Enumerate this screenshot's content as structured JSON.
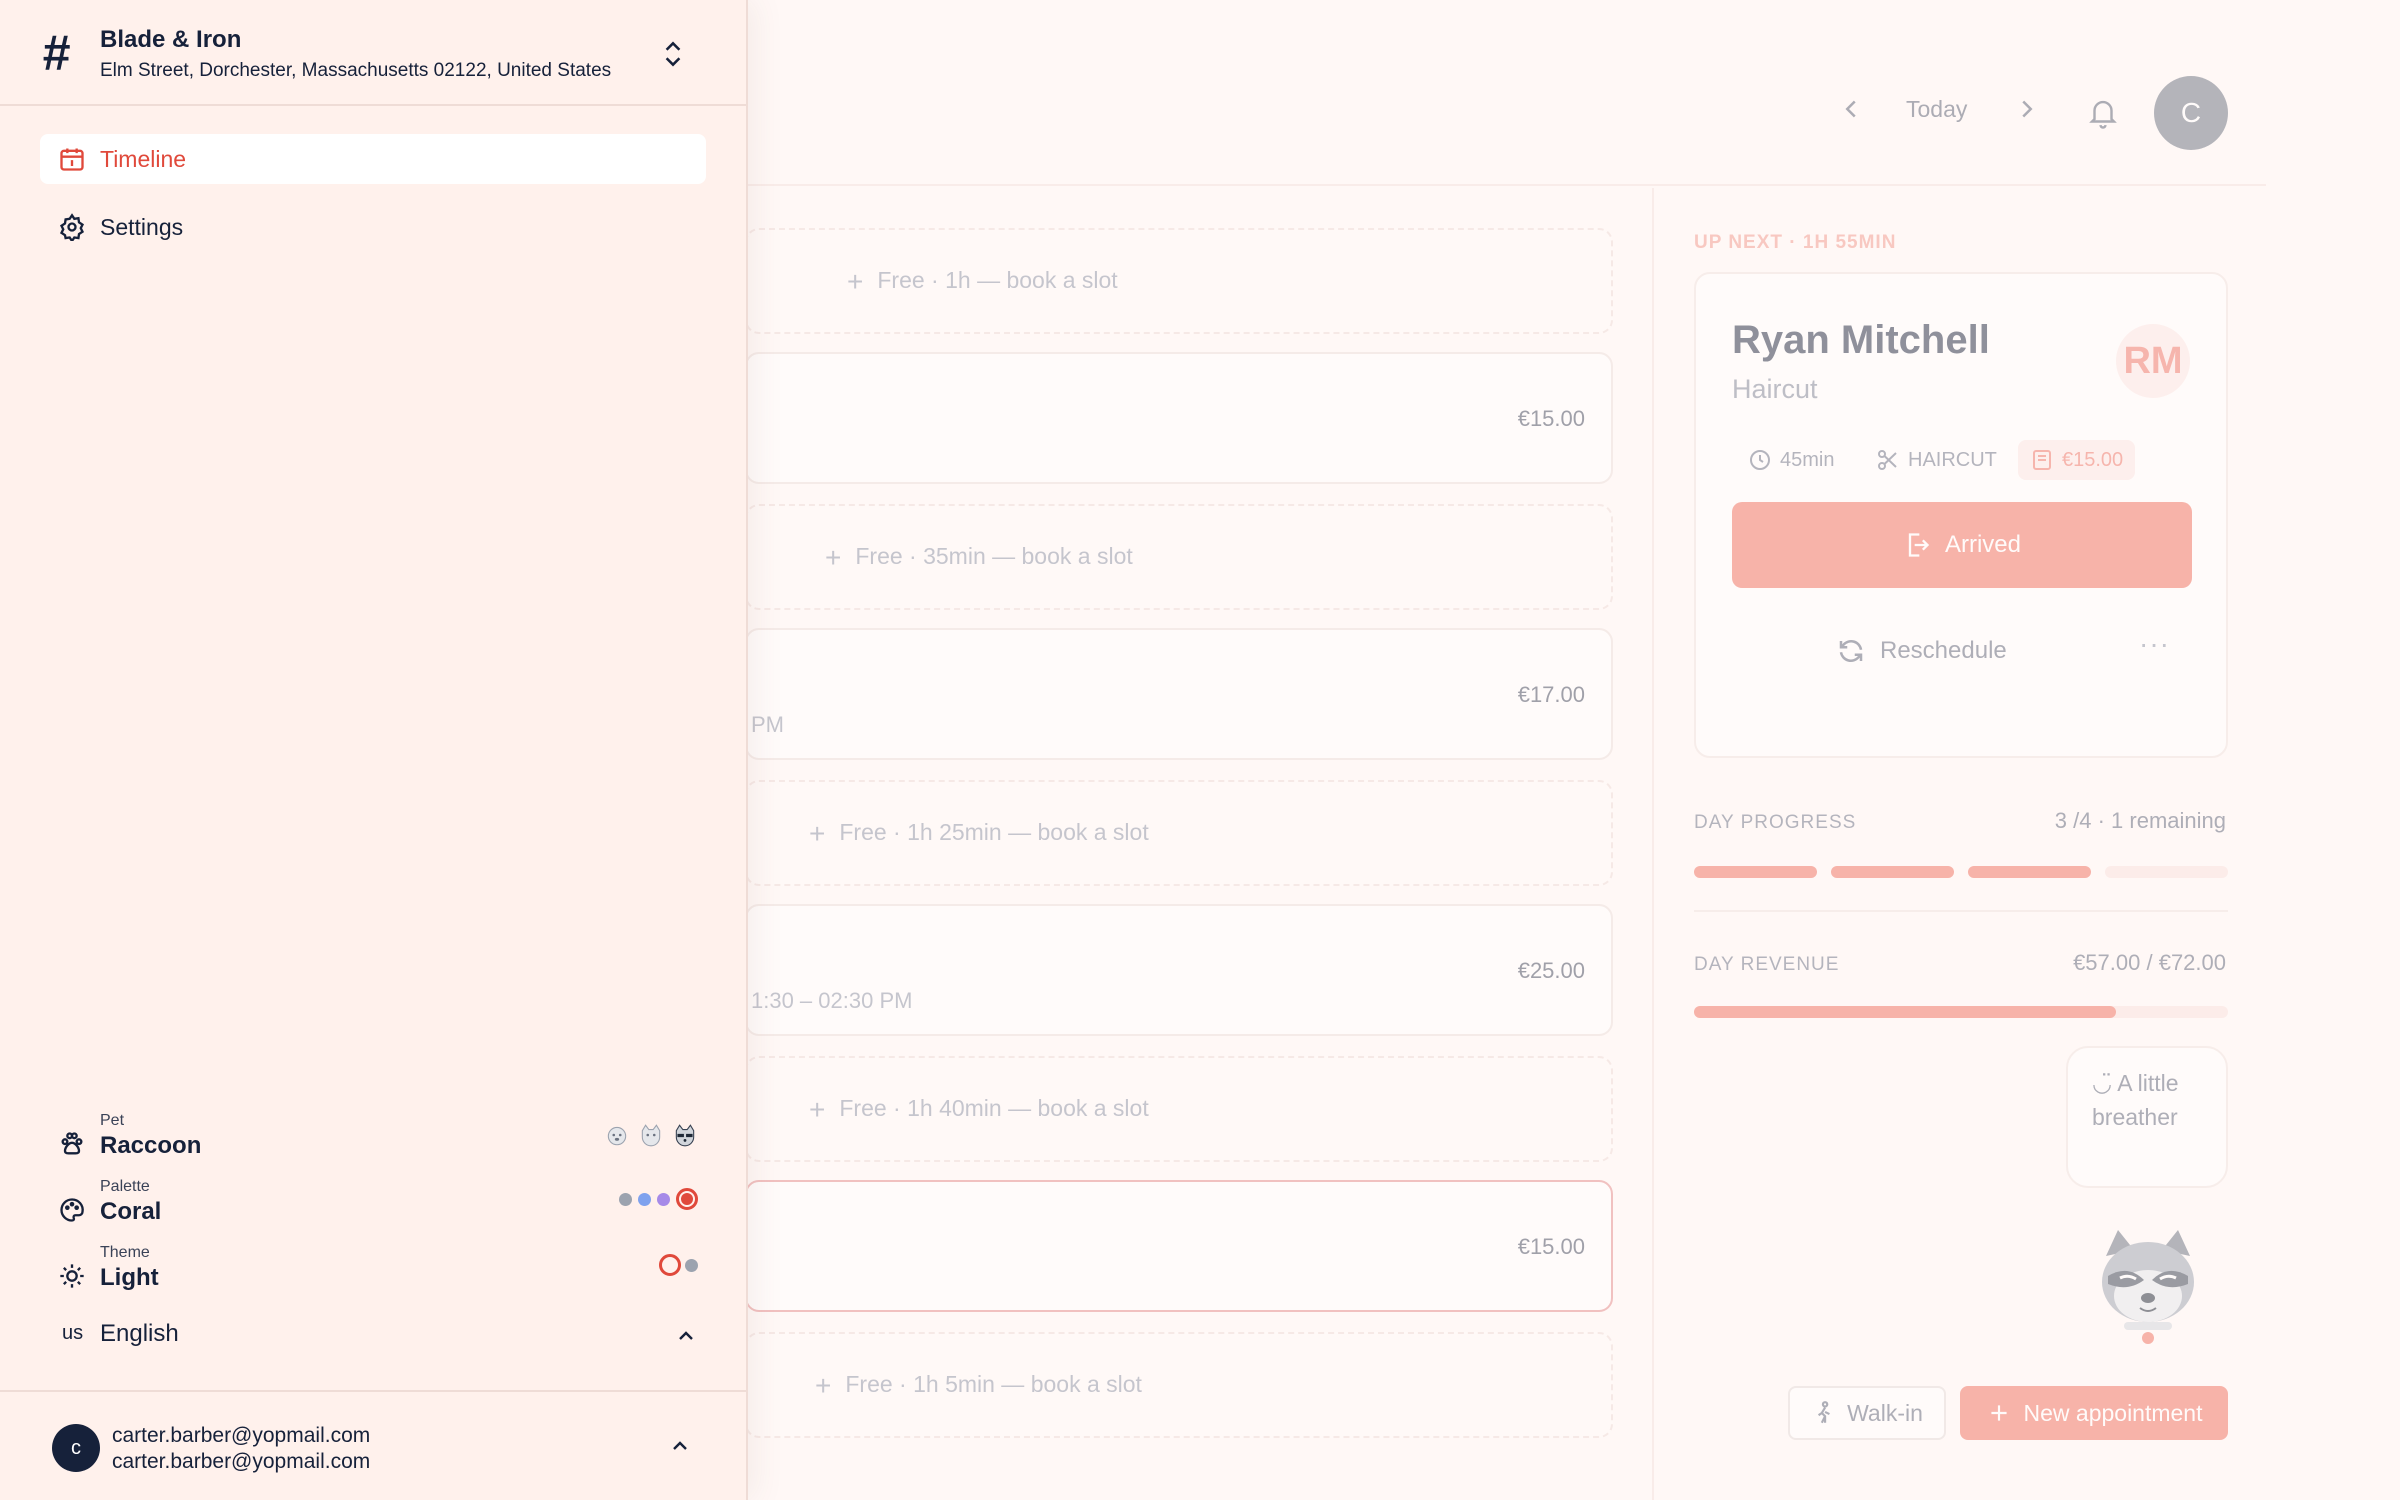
{
  "org": {
    "name": "Blade & Iron",
    "address": "Elm Street, Dorchester, Massachusetts 02122, United States"
  },
  "nav": {
    "items": [
      {
        "label": "Timeline",
        "icon": "calendar-icon",
        "active": true
      },
      {
        "label": "Settings",
        "icon": "gear-icon",
        "active": false
      }
    ]
  },
  "prefs": {
    "pet": {
      "label": "Pet",
      "value": "Raccoon"
    },
    "palette": {
      "label": "Palette",
      "value": "Coral"
    },
    "theme": {
      "label": "Theme",
      "value": "Light"
    },
    "language": {
      "flag": "us",
      "value": "English"
    }
  },
  "user": {
    "avatar": "c",
    "email": "carter.barber@yopmail.com",
    "email_secondary": "carter.barber@yopmail.com"
  },
  "topbar": {
    "today_label": "Today",
    "avatar": "C"
  },
  "timeline": {
    "slots": [
      {
        "kind": "free",
        "text": "Free · 1h — book a slot"
      },
      {
        "kind": "appt",
        "price": "€15.00",
        "sub": ""
      },
      {
        "kind": "free",
        "text": "Free · 35min — book a slot"
      },
      {
        "kind": "appt",
        "price": "€17.00",
        "sub": "PM"
      },
      {
        "kind": "free",
        "text": "Free · 1h 25min — book a slot"
      },
      {
        "kind": "appt",
        "price": "€25.00",
        "sub": "1:30 – 02:30 PM"
      },
      {
        "kind": "free",
        "text": "Free · 1h 40min — book a slot"
      },
      {
        "kind": "appt",
        "price": "€15.00",
        "sub": "",
        "highlight": true
      },
      {
        "kind": "free",
        "text": "Free · 1h 5min — book a slot"
      }
    ]
  },
  "upnext": {
    "label": "UP NEXT · 1H 55MIN",
    "name": "Ryan Mitchell",
    "service": "Haircut",
    "initials": "RM",
    "duration": "45min",
    "category": "HAIRCUT",
    "price": "€15.00",
    "arrived_label": "Arrived",
    "reschedule_label": "Reschedule",
    "more_label": "···"
  },
  "day_progress": {
    "label": "DAY PROGRESS",
    "done": "3",
    "total": "/4",
    "remaining": "· 1 remaining",
    "segments_total": 4,
    "segments_done": 3
  },
  "day_revenue": {
    "label": "DAY REVENUE",
    "earned": "€57.00",
    "separator": " / ",
    "expected": "€72.00",
    "fraction": 0.79
  },
  "mascot": {
    "bubble_text": "A little breather"
  },
  "actions": {
    "walkin_label": "Walk-in",
    "new_appointment_label": "New appointment"
  },
  "colors": {
    "accent": "#e0493b",
    "coral": "#f1705f",
    "navy": "#16213a"
  }
}
